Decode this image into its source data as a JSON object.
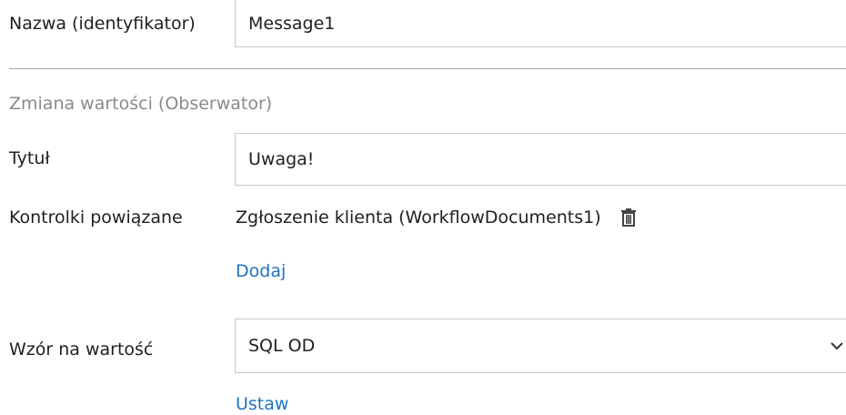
{
  "name": {
    "label": "Nazwa (identyfikator)",
    "value": "Message1"
  },
  "section": {
    "title": "Zmiana wartości (Obserwator)"
  },
  "title_field": {
    "label": "Tytuł",
    "value": "Uwaga!"
  },
  "related_controls": {
    "label": "Kontrolki powiązane",
    "item": "Zgłoszenie klienta (WorkflowDocuments1)",
    "add_link": "Dodaj",
    "delete_icon": "trash-icon"
  },
  "formula": {
    "label": "Wzór na wartość",
    "selected": "SQL OD",
    "set_link": "Ustaw",
    "dropdown_icon": "chevron-down-icon"
  },
  "colors": {
    "link": "#1e73be",
    "section_title": "#8a8a8a",
    "border": "#c8c8c8"
  }
}
